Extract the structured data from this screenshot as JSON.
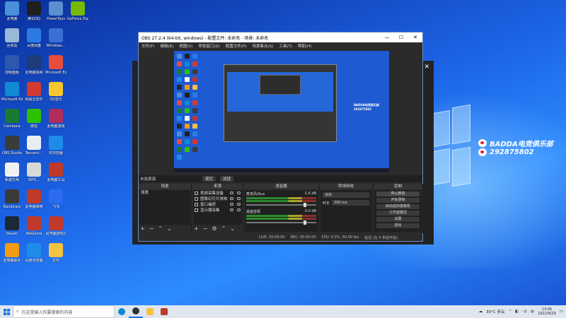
{
  "desktop": {
    "icons": [
      {
        "label": "此电脑",
        "color": "#4a90d9"
      },
      {
        "label": "腾讯QQ",
        "color": "#1f1f1f"
      },
      {
        "label": "PowerToys",
        "color": "#5b8fd1"
      },
      {
        "label": "GeForce Experience",
        "color": "#76b900"
      },
      {
        "label": "回收站",
        "color": "#9ab8d8"
      },
      {
        "label": "百度网盘",
        "color": "#2c7be5"
      },
      {
        "label": "Windows...",
        "color": "#3b6fd3"
      },
      {
        "label": "",
        "color": "#00000000"
      },
      {
        "label": "控制面板",
        "color": "#2d58b0"
      },
      {
        "label": "此电脑视频",
        "color": "#1d3c78"
      },
      {
        "label": "Microsoft Edge...",
        "color": "#e74c3c"
      },
      {
        "label": "",
        "color": "#00000000"
      },
      {
        "label": "Microsoft Edge",
        "color": "#0f8ad3"
      },
      {
        "label": "网易云音乐",
        "color": "#d33a31"
      },
      {
        "label": "QQ音乐",
        "color": "#f7c72f"
      },
      {
        "label": "",
        "color": "#00000000"
      },
      {
        "label": "Camtasia",
        "color": "#1a7a32"
      },
      {
        "label": "微信",
        "color": "#2dc100"
      },
      {
        "label": "此电脑游戏",
        "color": "#b02e5a"
      },
      {
        "label": "",
        "color": "#00000000"
      },
      {
        "label": "OBS Studio",
        "color": "#3b3b3b"
      },
      {
        "label": "Tencent...",
        "color": "#e9eef5"
      },
      {
        "label": "IE浏览器",
        "color": "#1e8de8"
      },
      {
        "label": "",
        "color": "#00000000"
      },
      {
        "label": "新建文档",
        "color": "#f1f1f1"
      },
      {
        "label": "WPS...",
        "color": "#d9d9d9"
      },
      {
        "label": "此电脑工具",
        "color": "#c0392b"
      },
      {
        "label": "",
        "color": "#00000000"
      },
      {
        "label": "Bandicam",
        "color": "#3a3a3a"
      },
      {
        "label": "此电脑维修",
        "color": "#c0392b"
      },
      {
        "label": "飞书",
        "color": "#2c6cf0"
      },
      {
        "label": "",
        "color": "#00000000"
      },
      {
        "label": "Steam",
        "color": "#1b2838"
      },
      {
        "label": "WeGame",
        "color": "#c0392b"
      },
      {
        "label": "此电脑游戏2",
        "color": "#c0392b"
      },
      {
        "label": "",
        "color": "#00000000"
      },
      {
        "label": "此电脑助手",
        "color": "#f39c12"
      },
      {
        "label": "百度浏览器",
        "color": "#1e8de8"
      },
      {
        "label": "文件",
        "color": "#f5c242"
      }
    ]
  },
  "badge": {
    "name": "BADDA电竞俱乐部",
    "number": "292875802"
  },
  "obs": {
    "title": "OBS 27.2.4 (64-bit, windows) - 配置文件: 未命名 - 场景: 未命名",
    "menu": [
      "文件(F)",
      "编辑(E)",
      "视图(V)",
      "停靠窗口(D)",
      "配置文件(P)",
      "场景集合(S)",
      "工具(T)",
      "帮助(H)"
    ],
    "scene_bar": {
      "label": "未选择源",
      "properties": "属性",
      "filters": "滤镜"
    },
    "docks": {
      "scenes": {
        "title": "场景",
        "items": [
          "场景"
        ]
      },
      "sources": {
        "title": "来源",
        "items": [
          "视频采集设备",
          "图像幻灯片放映",
          "窗口捕获",
          "显示器采集"
        ]
      },
      "mixer": {
        "title": "混音器",
        "channels": [
          {
            "name": "麦克风/Aux",
            "db": "-1.6 dB"
          },
          {
            "name": "桌面音频",
            "db": "0.0 dB"
          }
        ]
      },
      "transitions": {
        "title": "转场特效",
        "type": "淡出",
        "duration_label": "时长",
        "duration": "300 ms"
      },
      "controls": {
        "title": "控制",
        "buttons": [
          "停止推流",
          "开始录制",
          "启动虚拟摄像机",
          "工作室模式",
          "设置",
          "退出"
        ]
      }
    },
    "status": [
      "LIVE: 00:00:00",
      "REC: 00:00:00",
      "CPU: 0.3%, 60.00 fps",
      "延迟 (在 5 秒后开始)"
    ]
  },
  "taskbar": {
    "search_placeholder": "在这里输入你要搜索的内容",
    "weather": "30°C 多云",
    "time": "13:05",
    "date": "2022/6/29"
  }
}
